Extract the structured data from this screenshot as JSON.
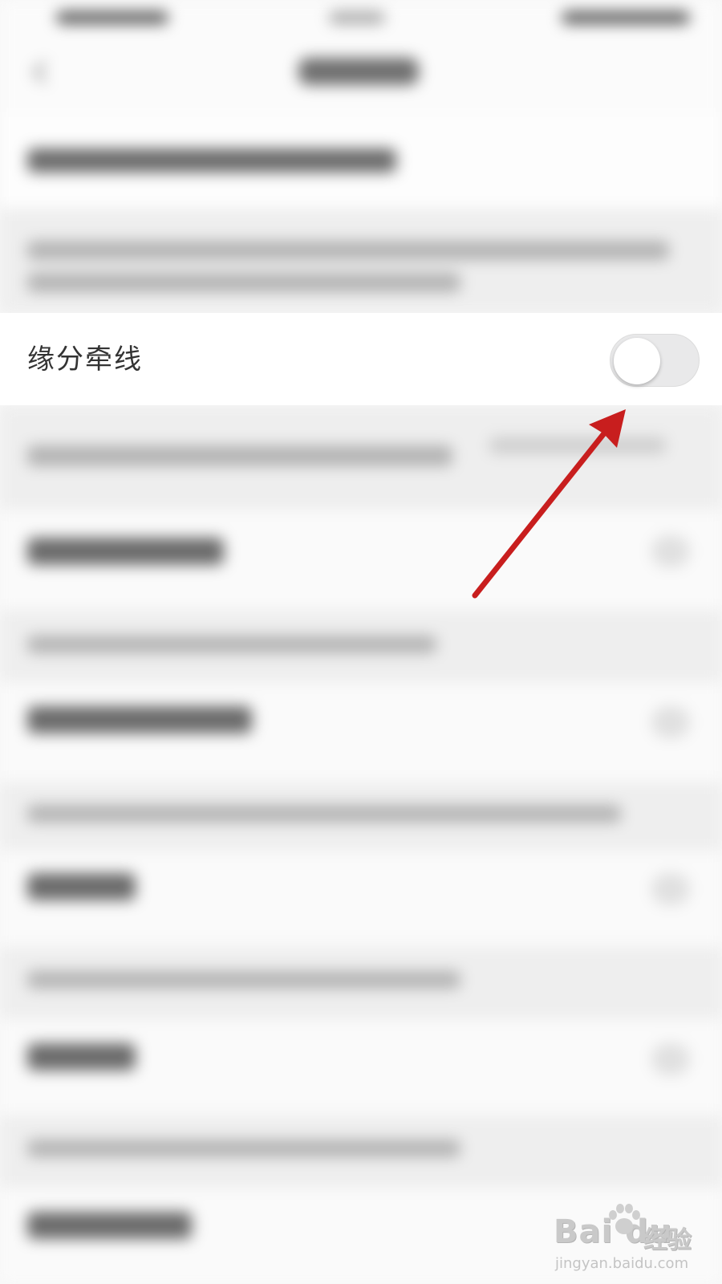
{
  "setting": {
    "label": "缘分牵线",
    "toggle_state": "off"
  },
  "annotation": {
    "arrow_color": "#c81e1e"
  },
  "watermark": {
    "brand": "Bai du",
    "product": "经验",
    "url": "jingyan.baidu.com"
  },
  "colors": {
    "background": "#f7f7f7",
    "row_background": "#ffffff",
    "toggle_track_off": "#e9e9ea",
    "label_text": "#333333"
  }
}
